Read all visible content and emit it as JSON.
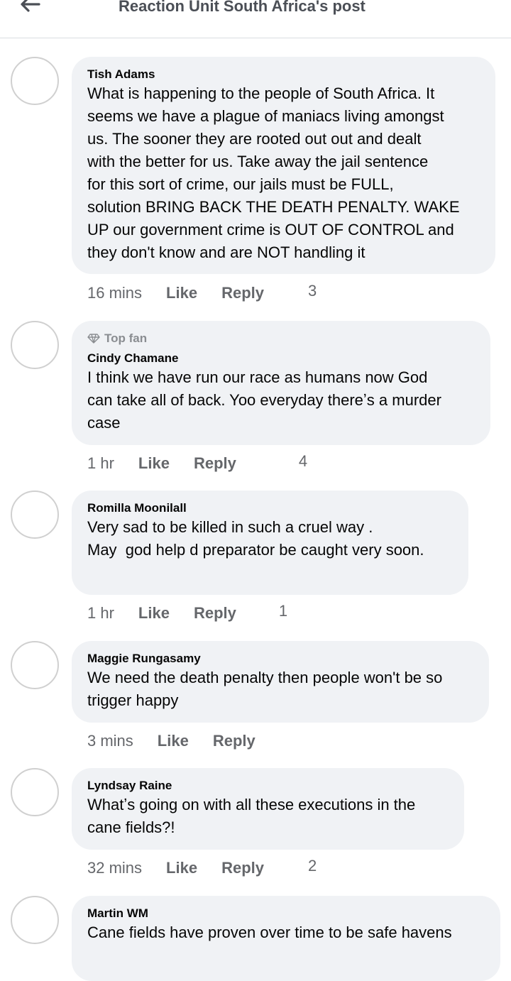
{
  "header": {
    "title": "Reaction Unit South Africa's post"
  },
  "comments": [
    {
      "author": "Tish Adams",
      "text": "What is happening to the people of South Africa. It seems we have a plague of maniacs living amongst us. The sooner they are rooted out out and dealt with the better for us. Take away the jail sentence for this sort of crime, our jails must be FULL, solution BRING BACK THE DEATH PENALTY. WAKE UP our government crime is OUT OF CONTROL and they don't know and are NOT handling it",
      "lines": [
        "What is happening to the people of South Africa. It",
        "seems we have a plague of maniacs living amongst",
        "us. The sooner they are rooted out out and dealt",
        "with the better for us. Take away the jail sentence",
        "for this sort of crime, our jails must be FULL,",
        "solution BRING BACK THE DEATH PENALTY. WAKE",
        "UP our government crime is OUT OF CONTROL and",
        "they don't know and are NOT handling it"
      ],
      "time": "16 mins",
      "like": "Like",
      "reply": "Reply",
      "reactions": "3"
    },
    {
      "badge": "Top fan",
      "author": "Cindy Chamane",
      "lines": [
        "I think we have run our race as humans now God",
        "can take all of back. Yoo everyday thereʼs a murder",
        "case"
      ],
      "time": "1 hr",
      "like": "Like",
      "reply": "Reply",
      "reactions": "4"
    },
    {
      "author": "Romilla Moonilall",
      "lines": [
        "Very sad to be killed in such a cruel way .",
        "May  god help d preparator be caught very soon."
      ],
      "time": "1 hr",
      "like": "Like",
      "reply": "Reply",
      "reactions": "1"
    },
    {
      "author": "Maggie Rungasamy",
      "lines": [
        "We need the death penalty then people won't be so",
        "trigger happy"
      ],
      "time": "3 mins",
      "like": "Like",
      "reply": "Reply",
      "reactions": ""
    },
    {
      "author": "Lyndsay Raine",
      "lines": [
        "Whatʼs going on with all these executions in the",
        "cane fields?!"
      ],
      "time": "32 mins",
      "like": "Like",
      "reply": "Reply",
      "reactions": "2"
    },
    {
      "author": "Martin WM",
      "lines": [
        "Cane fields have proven over time to be safe havens"
      ]
    }
  ]
}
